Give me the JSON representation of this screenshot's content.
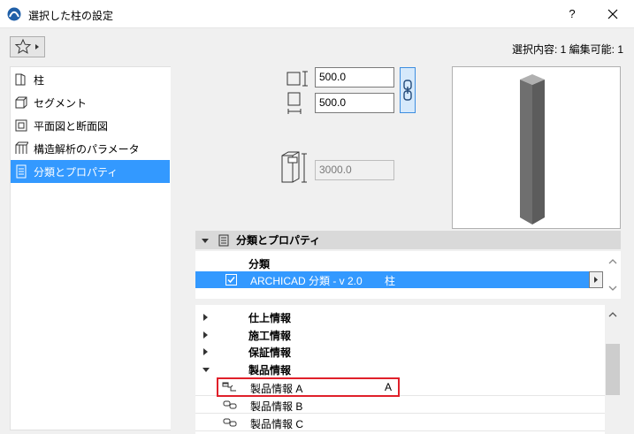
{
  "window": {
    "title": "選択した柱の設定",
    "help_label": "?",
    "close_icon": "close-icon"
  },
  "toolbar": {
    "favorites_icon": "star-icon",
    "selection_info": "選択内容: 1 編集可能: 1"
  },
  "sidebar": {
    "items": [
      {
        "label": "柱",
        "icon": "column-icon"
      },
      {
        "label": "セグメント",
        "icon": "segment-icon"
      },
      {
        "label": "平面図と断面図",
        "icon": "floorplan-section-icon"
      },
      {
        "label": "構造解析のパラメータ",
        "icon": "structural-analysis-icon"
      },
      {
        "label": "分類とプロパティ",
        "icon": "classification-icon",
        "selected": true
      }
    ]
  },
  "dimensions": {
    "width": "500.0",
    "depth": "500.0",
    "height": "3000.0"
  },
  "classification_section": {
    "title": "分類とプロパティ",
    "heading": "分類",
    "row_checked": true,
    "row_label": "ARCHICAD 分類 - v 2.0",
    "row_value": "柱"
  },
  "properties": {
    "groups": [
      {
        "label": "仕上情報",
        "expanded": false
      },
      {
        "label": "施工情報",
        "expanded": false
      },
      {
        "label": "保証情報",
        "expanded": false
      },
      {
        "label": "製品情報",
        "expanded": true
      }
    ],
    "rows": [
      {
        "label": "製品情報 A",
        "value": "A"
      },
      {
        "label": "製品情報 B",
        "value": ""
      },
      {
        "label": "製品情報 C",
        "value": ""
      }
    ]
  },
  "colors": {
    "selection": "#3399ff",
    "highlight_border": "#e0202a",
    "column_dark": "#7a7a7a",
    "column_top": "#a9a9a9"
  }
}
